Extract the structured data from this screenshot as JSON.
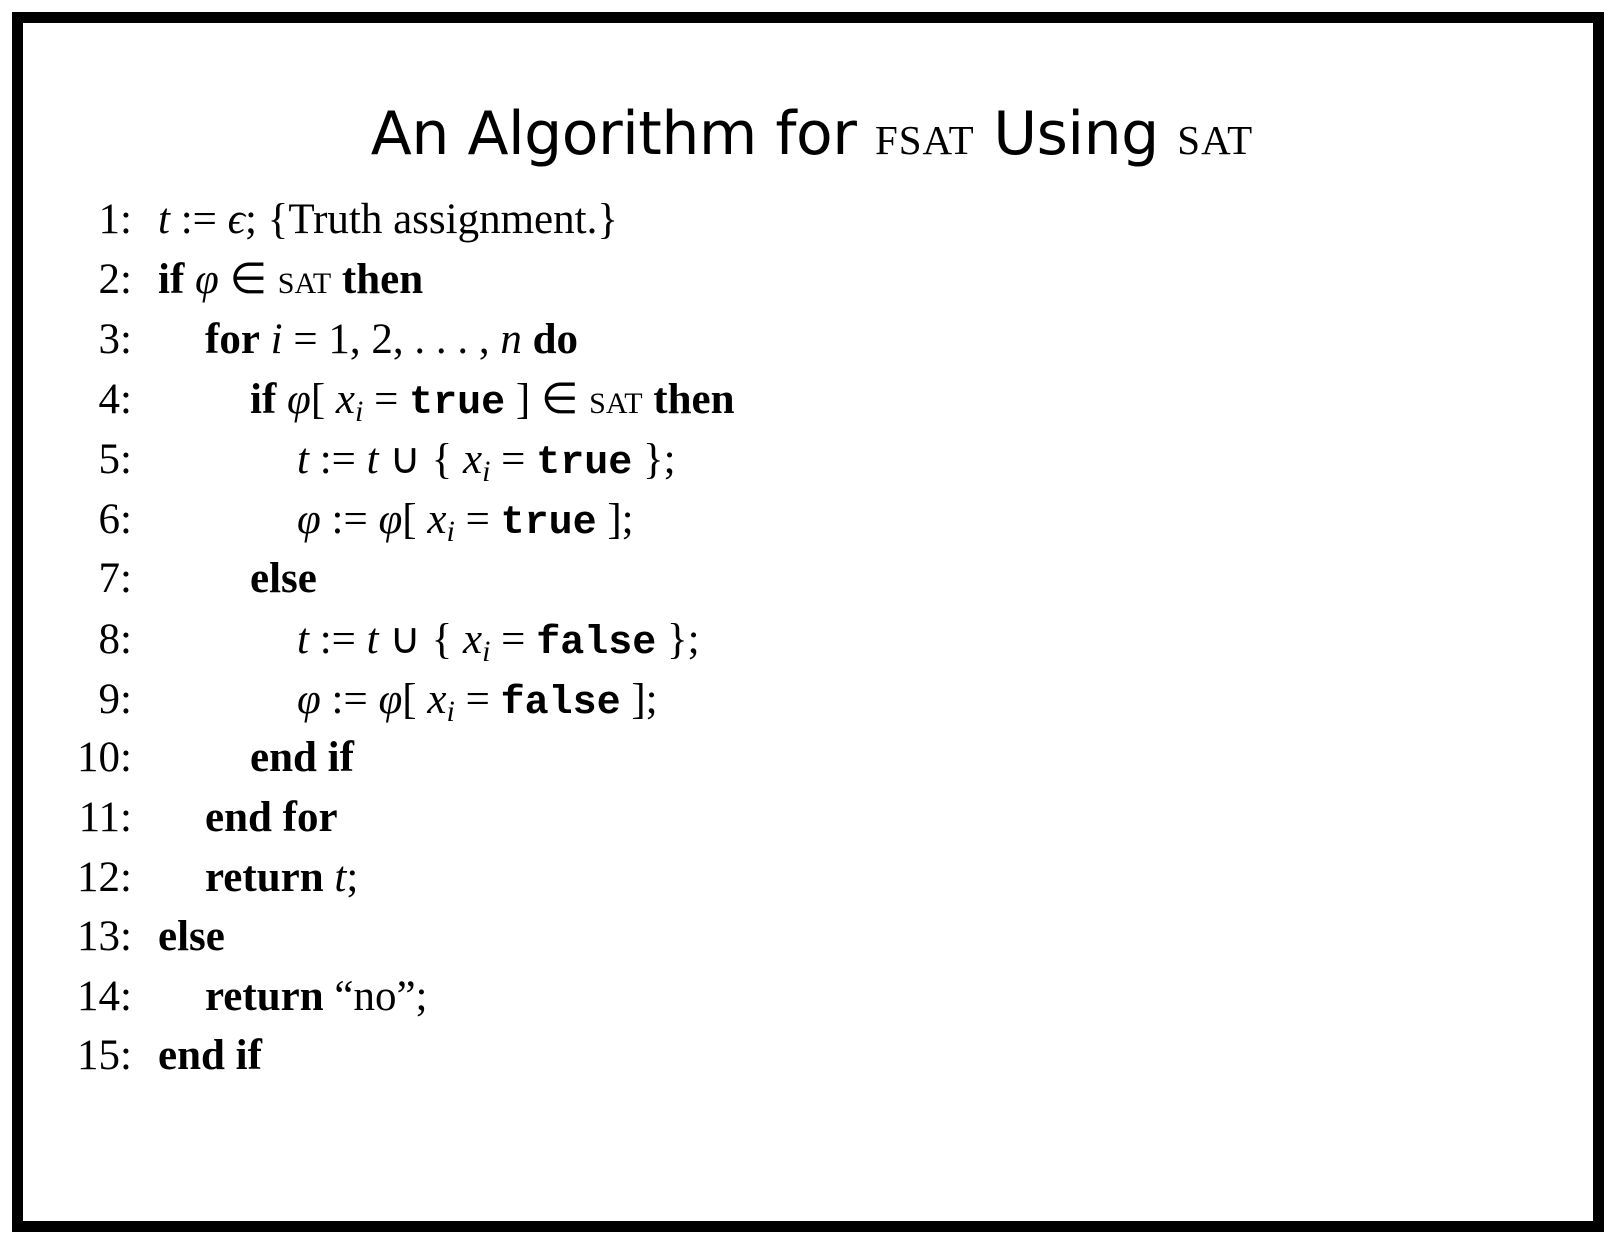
{
  "title": {
    "prefix": "An Algorithm for ",
    "fsat": "fsat",
    "middle": " Using ",
    "sat": "sat"
  },
  "kw": {
    "if": "if",
    "then": "then",
    "for": "for",
    "do": "do",
    "else": "else",
    "end_if": "end if",
    "end_for": "end for",
    "return": "return"
  },
  "sym": {
    "t": "t",
    "assign": " := ",
    "epsilon": "ϵ",
    "phi": "φ",
    "in": " ∈ ",
    "sat": "sat",
    "i": "i",
    "eq": " = ",
    "n": "n",
    "x": "x",
    "union": " ∪ ",
    "true": "true",
    "false": "false",
    "lbrace": " { ",
    "rbrace": " };",
    "lbrack": "[ ",
    "rbrack": " ]",
    "rbrack_semi": " ];",
    "semi": ";"
  },
  "text": {
    "l1_rest": "; {Truth assignment.}",
    "l3_range": " = 1, 2, . . . , ",
    "l14_value": " “no”;"
  },
  "line_numbers": [
    "1:",
    "2:",
    "3:",
    "4:",
    "5:",
    "6:",
    "7:",
    "8:",
    "9:",
    "10:",
    "11:",
    "12:",
    "13:",
    "14:",
    "15:"
  ]
}
